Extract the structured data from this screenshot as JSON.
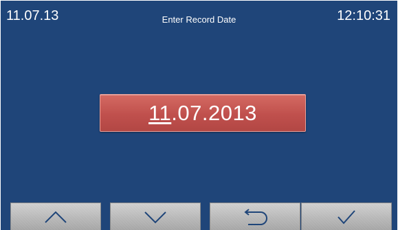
{
  "header": {
    "date": "11.07.13",
    "title": "Enter Record Date",
    "time": "12:10:31"
  },
  "editor": {
    "day": "11",
    "rest": ".07.2013",
    "selected_field": "day"
  },
  "softkeys": [
    {
      "name": "up",
      "icon": "chevron-up-icon"
    },
    {
      "name": "down",
      "icon": "chevron-down-icon"
    },
    {
      "name": "back",
      "icon": "return-arrow-icon"
    },
    {
      "name": "confirm",
      "icon": "checkmark-icon"
    }
  ],
  "colors": {
    "background": "#1f4579",
    "date_button": "#c0504d",
    "softkey": "#b8b8b8",
    "icon": "#1f4579"
  }
}
